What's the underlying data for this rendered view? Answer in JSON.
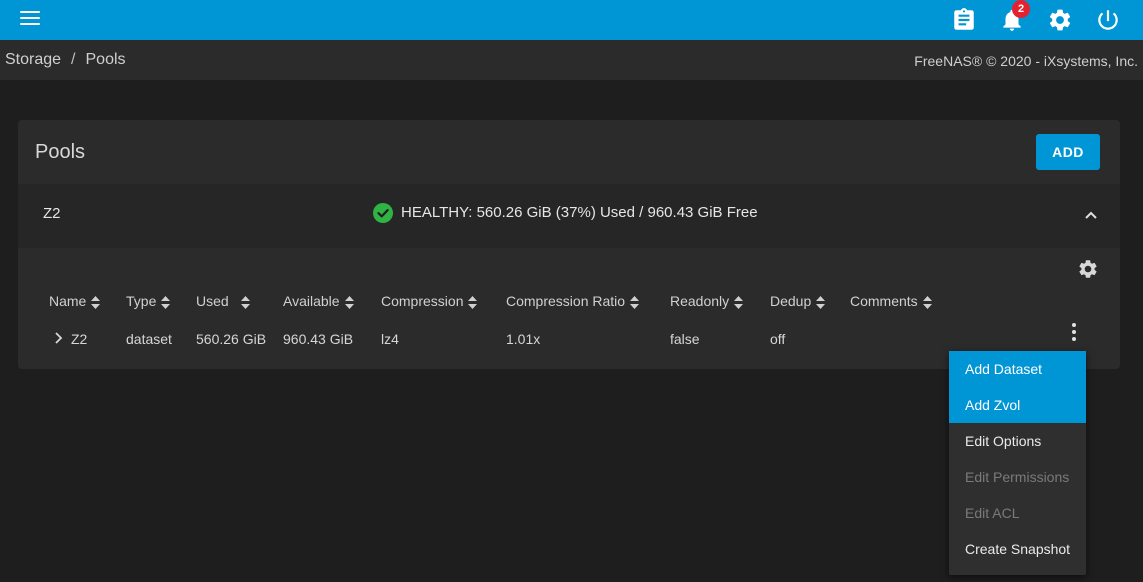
{
  "topbar": {
    "accent_color": "#0095d5",
    "icons": [
      "menu-icon",
      "clipboard-icon",
      "bell-icon",
      "gear-icon",
      "power-icon"
    ],
    "notification_count": "2"
  },
  "breadcrumb": {
    "items": [
      "Storage",
      "Pools"
    ],
    "separator": "/"
  },
  "copyright": "FreeNAS® © 2020 - iXsystems, Inc.",
  "pools": {
    "title": "Pools",
    "add_label": "ADD",
    "pool": {
      "name": "Z2",
      "status": "HEALTHY: 560.26 GiB (37%) Used / 960.43 GiB Free",
      "status_color": "#2fb344"
    },
    "table": {
      "columns": [
        "Name",
        "Type",
        "Used",
        "Available",
        "Compression",
        "Compression Ratio",
        "Readonly",
        "Dedup",
        "Comments"
      ],
      "rows": [
        {
          "name": "Z2",
          "type": "dataset",
          "used": "560.26 GiB",
          "available": "960.43 GiB",
          "compression": "lz4",
          "compression_ratio": "1.01x",
          "readonly": "false",
          "dedup": "off",
          "comments": ""
        }
      ]
    }
  },
  "context_menu": {
    "items": [
      {
        "label": "Add Dataset",
        "state": "highlighted"
      },
      {
        "label": "Add Zvol",
        "state": "highlighted"
      },
      {
        "label": "Edit Options",
        "state": "enabled"
      },
      {
        "label": "Edit Permissions",
        "state": "disabled"
      },
      {
        "label": "Edit ACL",
        "state": "disabled"
      },
      {
        "label": "Create Snapshot",
        "state": "enabled"
      }
    ]
  }
}
